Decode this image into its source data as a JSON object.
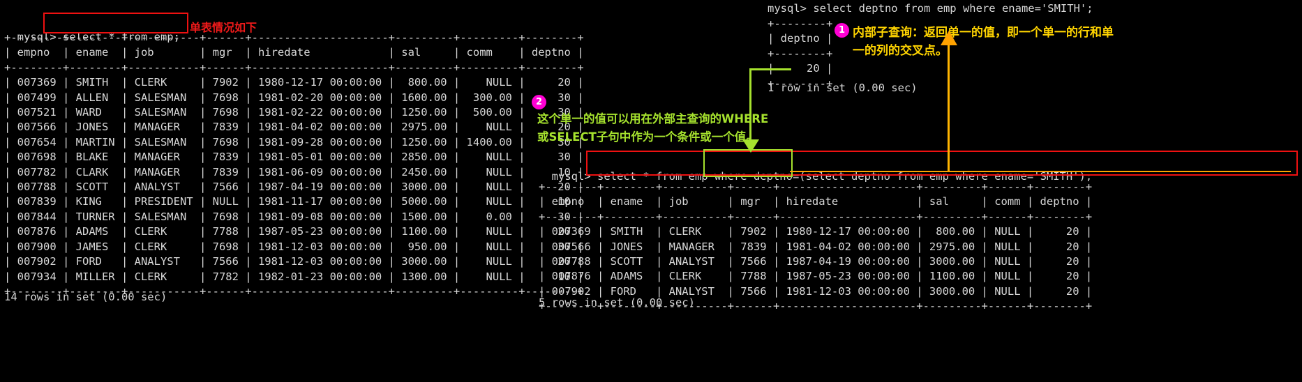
{
  "terminal": {
    "left_query_prompt": "mysql>",
    "left_query": " select * from emp;",
    "left_table": "+--------+--------+-----------+------+---------------------+---------+---------+--------+\n| empno  | ename  | job       | mgr  | hiredate            | sal     | comm    | deptno |\n+--------+--------+-----------+------+---------------------+---------+---------+--------+\n| 007369 | SMITH  | CLERK     | 7902 | 1980-12-17 00:00:00 |  800.00 |    NULL |     20 |\n| 007499 | ALLEN  | SALESMAN  | 7698 | 1981-02-20 00:00:00 | 1600.00 |  300.00 |     30 |\n| 007521 | WARD   | SALESMAN  | 7698 | 1981-02-22 00:00:00 | 1250.00 |  500.00 |     30 |\n| 007566 | JONES  | MANAGER   | 7839 | 1981-04-02 00:00:00 | 2975.00 |    NULL |     20 |\n| 007654 | MARTIN | SALESMAN  | 7698 | 1981-09-28 00:00:00 | 1250.00 | 1400.00 |     30 |\n| 007698 | BLAKE  | MANAGER   | 7839 | 1981-05-01 00:00:00 | 2850.00 |    NULL |     30 |\n| 007782 | CLARK  | MANAGER   | 7839 | 1981-06-09 00:00:00 | 2450.00 |    NULL |     10 |\n| 007788 | SCOTT  | ANALYST   | 7566 | 1987-04-19 00:00:00 | 3000.00 |    NULL |     20 |\n| 007839 | KING   | PRESIDENT | NULL | 1981-11-17 00:00:00 | 5000.00 |    NULL |     10 |\n| 007844 | TURNER | SALESMAN  | 7698 | 1981-09-08 00:00:00 | 1500.00 |    0.00 |     30 |\n| 007876 | ADAMS  | CLERK     | 7788 | 1987-05-23 00:00:00 | 1100.00 |    NULL |     20 |\n| 007900 | JAMES  | CLERK     | 7698 | 1981-12-03 00:00:00 |  950.00 |    NULL |     30 |\n| 007902 | FORD   | ANALYST   | 7566 | 1981-12-03 00:00:00 | 3000.00 |    NULL |     20 |\n| 007934 | MILLER | CLERK     | 7782 | 1982-01-23 00:00:00 | 1300.00 |    NULL |     10 |\n+--------+--------+-----------+------+---------------------+---------+---------+--------+",
    "left_status": "14 rows in set (0.00 sec)",
    "sub_query_line": "mysql> select deptno from emp where ename='SMITH';",
    "sub_table": "+--------+\n| deptno |\n+--------+\n|     20 |\n+--------+",
    "sub_status": "1 row in set (0.00 sec)",
    "main_query_prompt": "mysql>",
    "main_query": " select * from emp where deptno=(select deptno from emp where ename='SMITH');",
    "main_table": "+--------+--------+----------+------+---------------------+---------+------+--------+\n| empno  | ename  | job      | mgr  | hiredate            | sal     | comm | deptno |\n+--------+--------+----------+------+---------------------+---------+------+--------+\n| 007369 | SMITH  | CLERK    | 7902 | 1980-12-17 00:00:00 |  800.00 | NULL |     20 |\n| 007566 | JONES  | MANAGER  | 7839 | 1981-04-02 00:00:00 | 2975.00 | NULL |     20 |\n| 007788 | SCOTT  | ANALYST  | 7566 | 1987-04-19 00:00:00 | 3000.00 | NULL |     20 |\n| 007876 | ADAMS  | CLERK    | 7788 | 1987-05-23 00:00:00 | 1100.00 | NULL |     20 |\n| 007902 | FORD   | ANALYST  | 7566 | 1981-12-03 00:00:00 | 3000.00 | NULL |     20 |\n+--------+--------+----------+------+---------------------+---------+------+--------+",
    "main_status": "5 rows in set (0.00 sec)"
  },
  "annotations": {
    "single_table_note": "单表情况如下",
    "badge_one": "1",
    "badge_two": "2",
    "note_one_line1": "内部子查询：返回单一的值，即一个单一的行和单",
    "note_one_line2": "一的列的交叉点。",
    "note_two_line1": "这个单一的值可以用在外部主查询的WHERE",
    "note_two_line2": "或SELECT子句中作为一个条件或一个值。"
  },
  "colors": {
    "red": "#ee1111",
    "yellow": "#ffd400",
    "green": "#a6e22e",
    "magenta": "#ff00d4",
    "orange": "#ffa200",
    "terminal_text": "#d8d8d8",
    "background": "#000000"
  }
}
